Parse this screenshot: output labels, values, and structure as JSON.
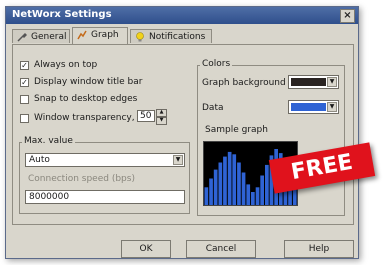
{
  "window": {
    "title": "NetWorx Settings",
    "close_glyph": "×"
  },
  "tabs": [
    {
      "label": "General",
      "icon": "tools-icon"
    },
    {
      "label": "Graph",
      "icon": "graph-icon"
    },
    {
      "label": "Notifications",
      "icon": "bulb-icon"
    }
  ],
  "checks": [
    {
      "label": "Always on top",
      "checked": true
    },
    {
      "label": "Display window title bar",
      "checked": true
    },
    {
      "label": "Snap to desktop edges",
      "checked": false
    },
    {
      "label": "Window transparency, %",
      "checked": false
    }
  ],
  "transparency_value": "50",
  "max_value": {
    "group_label": "Max. value",
    "selected": "Auto",
    "speed_label": "Connection speed (bps)",
    "speed_value": "8000000"
  },
  "colors": {
    "group_label": "Colors",
    "graph_background_label": "Graph background",
    "graph_background_color": "#2a2422",
    "data_label": "Data",
    "data_color": "#2f63d4",
    "sample_label": "Sample graph"
  },
  "sample_graph_series": [
    0.3,
    0.45,
    0.6,
    0.72,
    0.82,
    0.9,
    0.86,
    0.72,
    0.55,
    0.35,
    0.22,
    0.3,
    0.5,
    0.68,
    0.84,
    0.95,
    0.88,
    0.7,
    0.5,
    0.3
  ],
  "buttons": {
    "ok": "OK",
    "cancel": "Cancel",
    "help": "Help"
  },
  "badge": "FREE"
}
